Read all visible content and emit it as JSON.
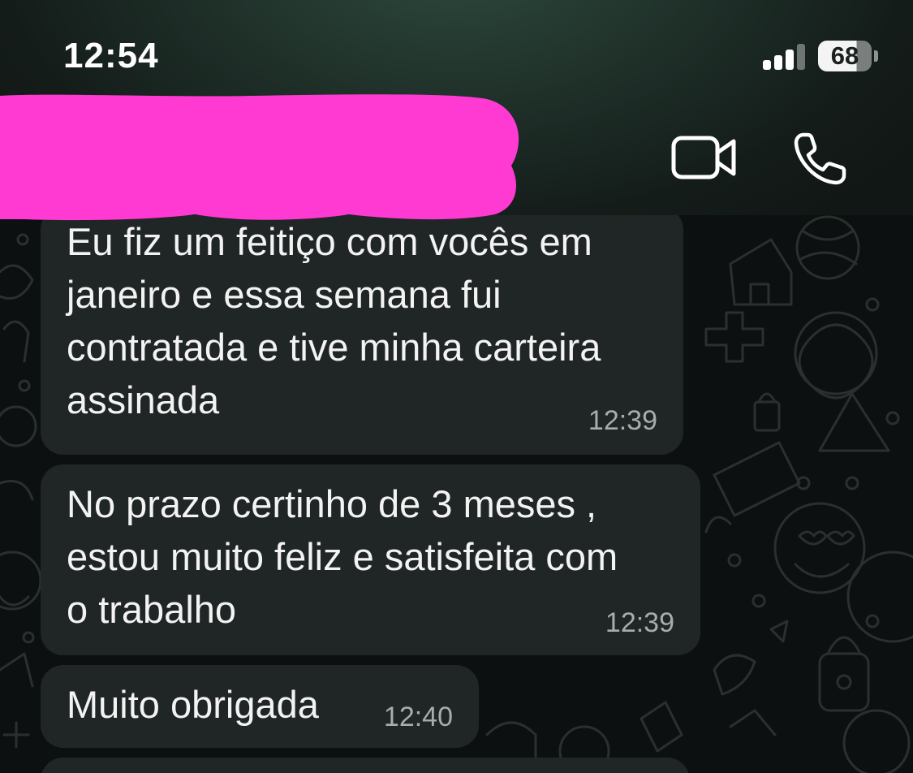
{
  "status_bar": {
    "time": "12:54",
    "battery_level": "68",
    "signal_icon": "cellular-signal-icon"
  },
  "header": {
    "contact_name_redacted": true,
    "video_call_icon": "video-camera-icon",
    "voice_call_icon": "phone-icon"
  },
  "messages": [
    {
      "text": "Eu fiz um feitiço com vocês em\njaneiro e essa semana fui\ncontratada e tive minha carteira\nassinada",
      "time": "12:39"
    },
    {
      "text": "No prazo certinho de 3 meses ,\nestou muito feliz e satisfeita com\no trabalho",
      "time": "12:39"
    },
    {
      "text": "Muito obrigada",
      "time": "12:40"
    }
  ],
  "colors": {
    "header_bg": "#1f3029",
    "chat_bg": "#0d1010",
    "bubble_bg": "#202525",
    "redaction": "#ff3ad2"
  }
}
